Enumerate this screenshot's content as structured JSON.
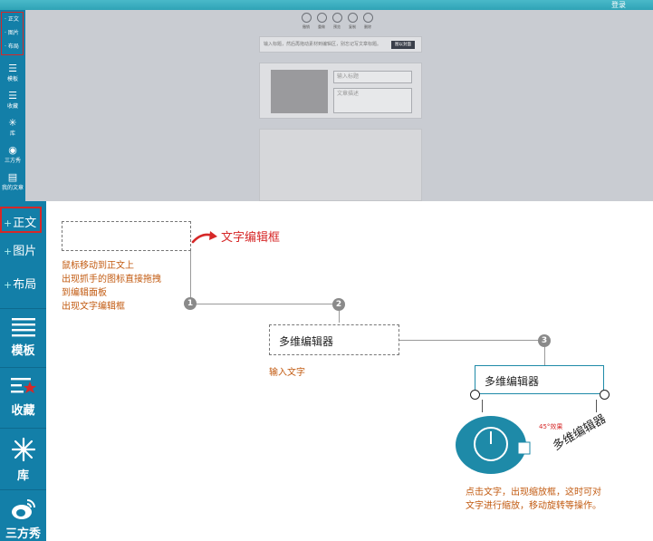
{
  "top_preview": {
    "login": "登录",
    "mini_sidebar": {
      "group": [
        "· 正文",
        "· 图片",
        "· 布局"
      ],
      "items": [
        {
          "icon": "list-icon",
          "label": "模板"
        },
        {
          "icon": "bookmark-icon",
          "label": "收藏"
        },
        {
          "icon": "asterisk-icon",
          "label": "库"
        },
        {
          "icon": "weibo-icon",
          "label": "三方秀"
        },
        {
          "icon": "document-icon",
          "label": "我的文章"
        }
      ]
    },
    "toolbar": [
      "撤销",
      "重做",
      "预览",
      "复制",
      "删除"
    ],
    "title_hint": "输入标题，然后再拖动素材到编辑区，别忘记写文章标题。",
    "title_button": "图以封面",
    "card_title_placeholder": "输入标题",
    "card_desc_placeholder": "文章描述"
  },
  "sidebar": {
    "zhengwen": "正文",
    "tupian": "图片",
    "buju": "布局",
    "plus": "+",
    "items": [
      {
        "icon": "list-icon",
        "label": "模板"
      },
      {
        "icon": "bookmark-icon",
        "label": "收藏"
      },
      {
        "icon": "asterisk-icon",
        "label": "库"
      },
      {
        "icon": "weibo-icon",
        "label": "三方秀"
      }
    ]
  },
  "tutorial": {
    "editbox_label": "文字编辑框",
    "step1_lines": [
      "鼠标移动到正文上",
      "出现抓手的图标直接拖拽",
      "到编辑面板",
      "出现文字编辑框"
    ],
    "steps": [
      "1",
      "2",
      "3"
    ],
    "editor_text": "多维编辑器",
    "step2_note": "输入文字",
    "rotate_label": "45°效果",
    "rotated_text": "多维编辑器",
    "step3_lines": [
      "点击文字，出现缩放框，这时可对",
      "文字进行缩放，移动旋转等操作。"
    ]
  },
  "colors": {
    "sidebar": "#137fa8",
    "accent_red": "#d62828",
    "note_orange": "#c25a10",
    "teal_box": "#1e8aa8"
  }
}
